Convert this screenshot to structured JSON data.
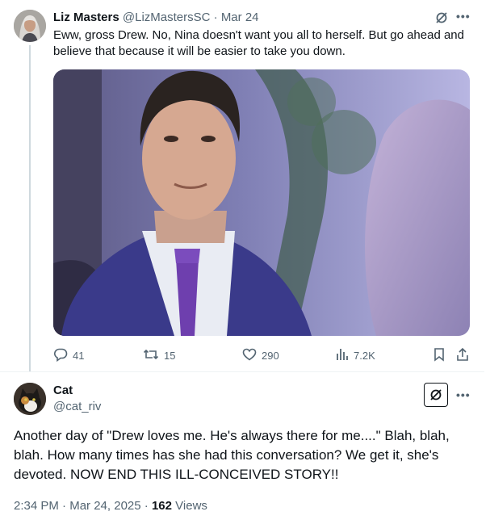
{
  "tweet1": {
    "author_name": "Liz Masters",
    "handle": "@LizMastersSC",
    "separator": "·",
    "date": "Mar 24",
    "text": "Eww, gross Drew. No, Nina doesn't want you all to herself. But go ahead and believe that because it will be easier to take you down.",
    "stats": {
      "replies": "41",
      "reposts": "15",
      "likes": "290",
      "views": "7.2K"
    }
  },
  "tweet2": {
    "author_name": "Cat",
    "handle": "@cat_riv",
    "text": "Another day of \"Drew loves me. He's always there for me....\" Blah, blah, blah. How many times has she had this conversation? We get it, she's devoted. NOW END THIS ILL-CONCEIVED STORY!!",
    "time": "2:34 PM",
    "date": "Mar 24, 2025",
    "views_count": "162",
    "views_label": "Views"
  },
  "icons": {
    "grok": "grok-icon",
    "more": "more-icon",
    "reply": "reply-icon",
    "repost": "repost-icon",
    "like": "like-icon",
    "views": "views-icon",
    "bookmark": "bookmark-icon",
    "share": "share-icon"
  },
  "colors": {
    "text": "#0f1419",
    "muted": "#536471",
    "divider": "#eff3f4",
    "thread": "#cfd9de"
  }
}
